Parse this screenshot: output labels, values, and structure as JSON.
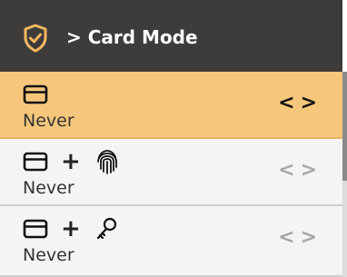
{
  "header": {
    "title": "> Card Mode",
    "icon": "shield-check-icon",
    "background": "#3e3b3b"
  },
  "items": [
    {
      "icons": [
        "card-icon"
      ],
      "value": "Never",
      "prev": "<",
      "next": ">",
      "selected": true
    },
    {
      "icons": [
        "card-icon",
        "plus",
        "fingerprint-icon"
      ],
      "plus": "+",
      "value": "Never",
      "prev": "<",
      "next": ">",
      "selected": false
    },
    {
      "icons": [
        "card-icon",
        "plus",
        "key-icon"
      ],
      "plus": "+",
      "value": "Never",
      "prev": "<",
      "next": ">",
      "selected": false
    }
  ],
  "colors": {
    "selected": "#f6c77b",
    "row": "#f6f4f3",
    "arrow_inactive": "#a7a7a7"
  }
}
